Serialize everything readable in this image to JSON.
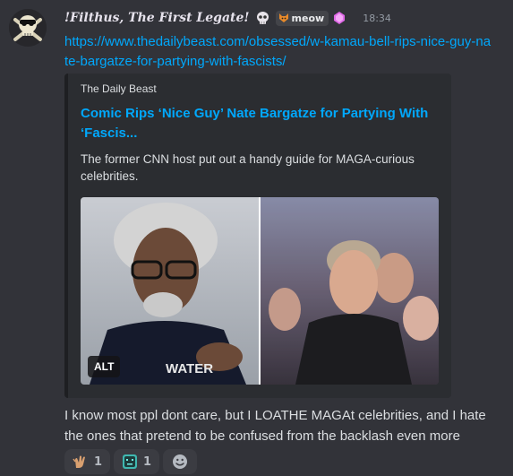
{
  "author": {
    "name": "!Filthus, The First Legate!",
    "avatar_icon": "skull-crossbones-avatar",
    "badge_icon": "skull-icon",
    "tag": {
      "label": "meow",
      "icon": "fox-tag-icon"
    },
    "role_icon": "gem-icon",
    "timestamp": "18:34"
  },
  "message": {
    "link": "https://www.thedailybeast.com/obsessed/w-kamau-bell-rips-nice-guy-nate-bargatze-for-partying-with-fascists/",
    "text": "I know most ppl dont care, but I LOATHE MAGAt celebrities, and I hate the ones that pretend to be confused from the backlash even more"
  },
  "embed": {
    "provider": "The Daily Beast",
    "title": "Comic Rips ‘Nice Guy’ Nate Bargatze for Partying With ‘Fascis...",
    "description": "The former CNN host put out a handy guide for MAGA-curious celebrities.",
    "alt_label": "ALT"
  },
  "reactions": [
    {
      "emoji": "clapping-hands-emoji",
      "count": "1"
    },
    {
      "emoji": "monitor-face-emoji",
      "count": "1"
    }
  ],
  "add_reaction_icon": "add-reaction-smiley-icon",
  "colors": {
    "background": "#323339",
    "link": "#00a8fc",
    "embed_bg": "#2b2d31",
    "text": "#dbdee1",
    "muted": "#949ba4"
  }
}
